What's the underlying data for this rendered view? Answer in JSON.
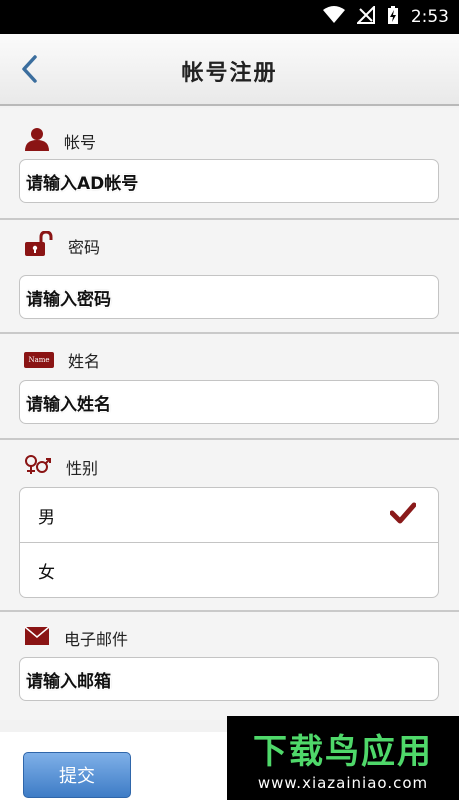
{
  "status_bar": {
    "time": "2:53"
  },
  "nav": {
    "title": "帐号注册"
  },
  "sections": {
    "account": {
      "label": "帐号",
      "placeholder": "请输入AD帐号"
    },
    "password": {
      "label": "密码",
      "placeholder": "请输入密码"
    },
    "name": {
      "label": "姓名",
      "placeholder": "请输入姓名",
      "badge_text": "Name"
    },
    "gender": {
      "label": "性别",
      "options": [
        "男",
        "女"
      ],
      "selected": "男"
    },
    "email": {
      "label": "电子邮件",
      "placeholder": "请输入邮箱"
    }
  },
  "actions": {
    "submit_label": "提交"
  },
  "watermark": {
    "title": "下载鸟应用",
    "url": "www.xiazainiao.com"
  },
  "colors": {
    "icon_red": "#8a1414",
    "check": "#8a1a1a",
    "button_blue": "#4a86cf"
  }
}
